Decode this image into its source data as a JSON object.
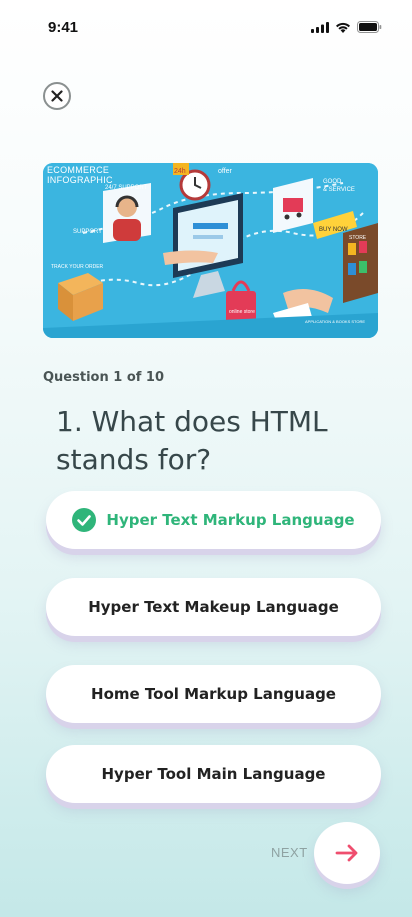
{
  "status_bar": {
    "time": "9:41",
    "icons": [
      "signal-icon",
      "wifi-icon",
      "battery-icon"
    ]
  },
  "header": {
    "close_icon": "close-icon"
  },
  "hero": {
    "caption_line1": "ECOMMERCE",
    "caption_line2": "INFOGRAPHIC",
    "sign_support": "24/7 SUPPORT",
    "sign_24h": "24h",
    "sign_offer": "offer",
    "sign_good": "GOOD",
    "sign_service": "& SERVICE",
    "sign_buy_now": "BUY NOW",
    "sign_support_side": "SUPPORT",
    "sign_track": "TRACK YOUR ORDER",
    "sign_online": "online store",
    "sign_app": "APPLICATION & BOOKS STORE",
    "sign_store": "STORE"
  },
  "quiz": {
    "question_count": "Question 1 of 10",
    "question": "1. What does HTML stands for?",
    "answers": [
      {
        "label": "Hyper Text Markup Language",
        "selected": true
      },
      {
        "label": "Hyper Text Makeup Language",
        "selected": false
      },
      {
        "label": "Home Tool Markup Language",
        "selected": false
      },
      {
        "label": "Hyper Tool Main Language",
        "selected": false
      }
    ]
  },
  "footer": {
    "next_label": "NEXT",
    "next_icon": "arrow-right-icon"
  },
  "colors": {
    "selected_answer": "#2fb57a",
    "next_arrow": "#ef4e6e",
    "hero_bg": "#3cb6e2"
  }
}
